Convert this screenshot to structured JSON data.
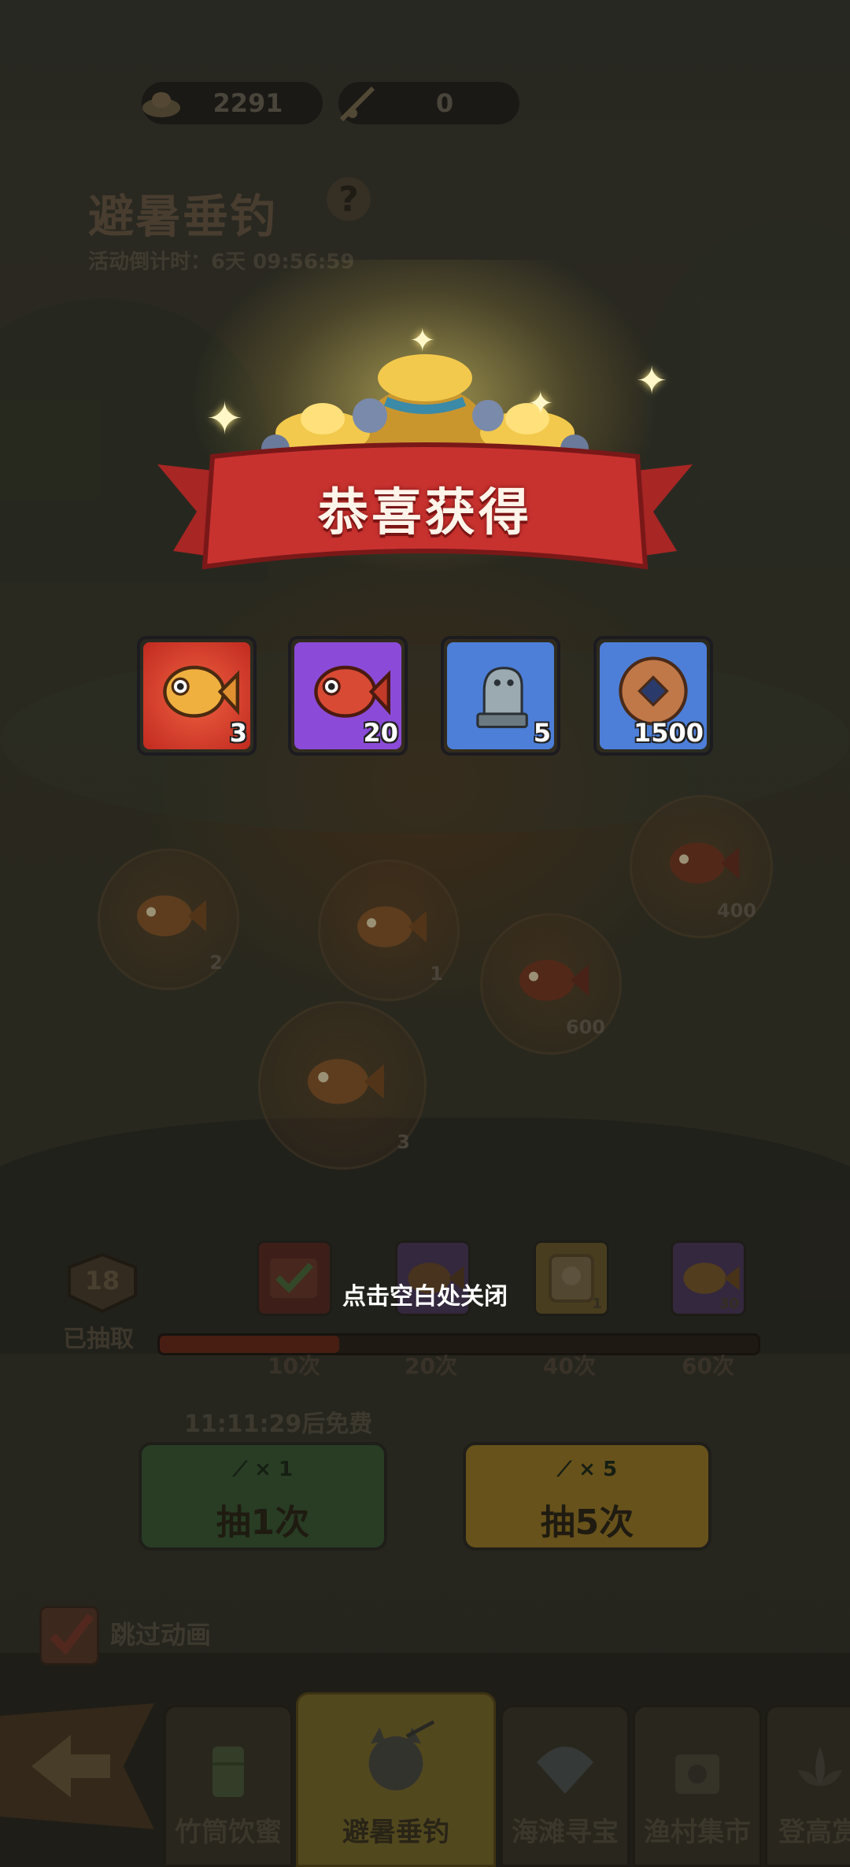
{
  "top_bar": {
    "ingot_count": "2291",
    "rod_count": "0"
  },
  "event": {
    "title": "避暑垂钓",
    "help_icon_text": "?",
    "countdown": "活动倒计时：6天 09:56:59"
  },
  "pond_bubbles": [
    {
      "count": "2"
    },
    {
      "count": "1"
    },
    {
      "count": "600"
    },
    {
      "count": "400"
    },
    {
      "count": "3"
    }
  ],
  "popup": {
    "title": "恭喜获得",
    "rewards": [
      {
        "icon": "golden-carp-icon",
        "qty": "3",
        "frame_color": "#d33a2a"
      },
      {
        "icon": "red-carp-icon",
        "qty": "20",
        "frame_color": "#8b4bd8"
      },
      {
        "icon": "stone-dragon-statue-icon",
        "qty": "5",
        "frame_color": "#4d7fd8"
      },
      {
        "icon": "copper-coin-icon",
        "qty": "1500",
        "frame_color": "#4d7fd8"
      }
    ],
    "close_hint": "点击空白处关闭"
  },
  "progress": {
    "badge_count": "18",
    "badge_label": "已抽取",
    "current_draws": 18,
    "max_draws": 60,
    "milestones": [
      {
        "label": "10次",
        "reward_icon": "checked-chest-icon",
        "count": ""
      },
      {
        "label": "20次",
        "reward_icon": "carp-icon",
        "count": ""
      },
      {
        "label": "40次",
        "reward_icon": "avatar-frame-icon",
        "count": "1"
      },
      {
        "label": "60次",
        "reward_icon": "golden-carp-icon",
        "count": "30"
      }
    ]
  },
  "draw": {
    "free_timer": "11:11:29后免费",
    "single": {
      "cost": "× 1",
      "label": "抽1次"
    },
    "five": {
      "cost": "× 5",
      "label": "抽5次"
    }
  },
  "skip_animation": {
    "label": "跳过动画",
    "checked": true
  },
  "bottom_nav": {
    "tabs": [
      {
        "label": "竹筒饮蜜",
        "icon": "bamboo-cup-icon",
        "active": false
      },
      {
        "label": "避暑垂钓",
        "icon": "fishing-cat-icon",
        "active": true
      },
      {
        "label": "海滩寻宝",
        "icon": "seashell-icon",
        "active": false
      },
      {
        "label": "渔村集市",
        "icon": "market-icon",
        "active": false
      },
      {
        "label": "登高赏",
        "icon": "lotus-icon",
        "active": false
      }
    ]
  },
  "colors": {
    "banner_red": "#c7322f",
    "gold": "#f5c842",
    "green_button": "#3f6b3a",
    "yellow_button": "#a8862a"
  }
}
